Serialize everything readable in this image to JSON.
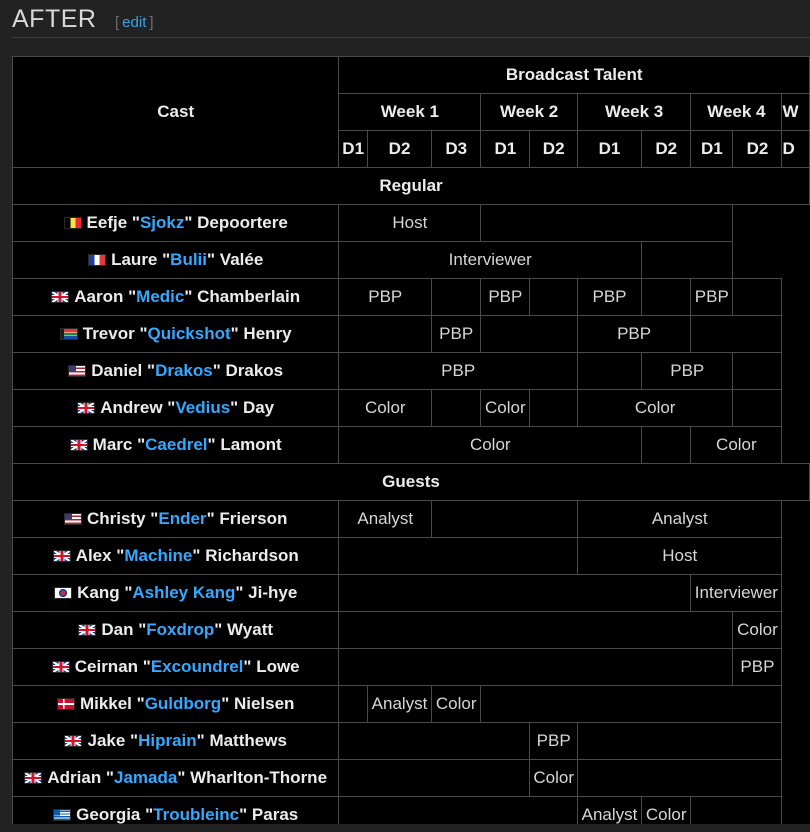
{
  "heading": {
    "title": "AFTER",
    "edit_open": "[",
    "edit_label": "edit",
    "edit_close": "]"
  },
  "table": {
    "header": {
      "cast": "Cast",
      "group": "Broadcast Talent",
      "weeks": [
        "Week 1",
        "Week 2",
        "Week 3",
        "Week 4",
        "W"
      ],
      "days": [
        "D1",
        "D2",
        "D3",
        "D1",
        "D2",
        "D1",
        "D2",
        "D1",
        "D2",
        "D"
      ]
    },
    "sections": [
      {
        "label": "Regular",
        "rows": [
          {
            "first": "Eefje \"",
            "nick": "Sjokz",
            "last": "\" Depoortere",
            "flag": "belgium-flag-icon",
            "cells": [
              {
                "text": "Host",
                "span": 3
              },
              {
                "text": "",
                "span": 5
              }
            ]
          },
          {
            "first": "Laure \"",
            "nick": "Bulii",
            "last": "\" Valée",
            "flag": "france-flag-icon",
            "cells": [
              {
                "text": "Interviewer",
                "span": 6
              },
              {
                "text": "",
                "span": 2
              }
            ]
          },
          {
            "first": "Aaron \"",
            "nick": "Medic",
            "last": "\" Chamberlain",
            "flag": "uk-flag-icon",
            "cells": [
              {
                "text": "PBP",
                "span": 2
              },
              {
                "text": "",
                "span": 1
              },
              {
                "text": "PBP",
                "span": 1
              },
              {
                "text": "",
                "span": 1
              },
              {
                "text": "PBP",
                "span": 1
              },
              {
                "text": "",
                "span": 1
              },
              {
                "text": "PBP",
                "span": 1
              },
              {
                "text": "",
                "span": 1
              }
            ]
          },
          {
            "first": "Trevor \"",
            "nick": "Quickshot",
            "last": "\" Henry",
            "flag": "south-africa-flag-icon",
            "cells": [
              {
                "text": "",
                "span": 2
              },
              {
                "text": "PBP",
                "span": 1
              },
              {
                "text": "",
                "span": 2
              },
              {
                "text": "PBP",
                "span": 2
              },
              {
                "text": "",
                "span": 2
              }
            ]
          },
          {
            "first": "Daniel \"",
            "nick": "Drakos",
            "last": "\" Drakos",
            "flag": "usa-flag-icon",
            "cells": [
              {
                "text": "PBP",
                "span": 5
              },
              {
                "text": "",
                "span": 1
              },
              {
                "text": "PBP",
                "span": 2
              },
              {
                "text": "",
                "span": 1
              }
            ]
          },
          {
            "first": "Andrew \"",
            "nick": "Vedius",
            "last": "\" Day",
            "flag": "uk-flag-icon",
            "cells": [
              {
                "text": "Color",
                "span": 2
              },
              {
                "text": "",
                "span": 1
              },
              {
                "text": "Color",
                "span": 1
              },
              {
                "text": "",
                "span": 1
              },
              {
                "text": "Color",
                "span": 3
              },
              {
                "text": "",
                "span": 1
              }
            ]
          },
          {
            "first": "Marc \"",
            "nick": "Caedrel",
            "last": "\" Lamont",
            "flag": "uk-flag-icon",
            "cells": [
              {
                "text": "Color",
                "span": 6
              },
              {
                "text": "",
                "span": 1
              },
              {
                "text": "Color",
                "span": 2
              }
            ]
          }
        ]
      },
      {
        "label": "Guests",
        "rows": [
          {
            "first": "Christy \"",
            "nick": "Ender",
            "last": "\" Frierson",
            "flag": "usa-flag-icon",
            "cells": [
              {
                "text": "Analyst",
                "span": 2
              },
              {
                "text": "",
                "span": 3
              },
              {
                "text": "Analyst",
                "span": 4
              }
            ]
          },
          {
            "first": "Alex \"",
            "nick": "Machine",
            "last": "\" Richardson",
            "flag": "uk-flag-icon",
            "cells": [
              {
                "text": "",
                "span": 5
              },
              {
                "text": "Host",
                "span": 4
              }
            ]
          },
          {
            "first": "Kang \"",
            "nick": "Ashley Kang",
            "last": "\" Ji-hye",
            "flag": "south-korea-flag-icon",
            "cells": [
              {
                "text": "",
                "span": 7
              },
              {
                "text": "Interviewer",
                "span": 2
              }
            ]
          },
          {
            "first": "Dan \"",
            "nick": "Foxdrop",
            "last": "\" Wyatt",
            "flag": "uk-flag-icon",
            "cells": [
              {
                "text": "",
                "span": 8
              },
              {
                "text": "Color",
                "span": 1
              }
            ]
          },
          {
            "first": "Ceirnan \"",
            "nick": "Excoundrel",
            "last": "\" Lowe",
            "flag": "uk-flag-icon",
            "cells": [
              {
                "text": "",
                "span": 8
              },
              {
                "text": "PBP",
                "span": 1
              }
            ]
          },
          {
            "first": "Mikkel \"",
            "nick": "Guldborg",
            "last": "\" Nielsen",
            "flag": "denmark-flag-icon",
            "cells": [
              {
                "text": "",
                "span": 1
              },
              {
                "text": "Analyst",
                "span": 1
              },
              {
                "text": "Color",
                "span": 1
              },
              {
                "text": "",
                "span": 6
              }
            ]
          },
          {
            "first": "Jake \"",
            "nick": "Hiprain",
            "last": "\" Matthews",
            "flag": "uk-flag-icon",
            "cells": [
              {
                "text": "",
                "span": 4
              },
              {
                "text": "PBP",
                "span": 1
              },
              {
                "text": "",
                "span": 4
              }
            ]
          },
          {
            "first": "Adrian \"",
            "nick": "Jamada",
            "last": "\" Wharlton-Thorne",
            "flag": "uk-flag-icon",
            "cells": [
              {
                "text": "",
                "span": 4
              },
              {
                "text": "Color",
                "span": 1
              },
              {
                "text": "",
                "span": 4
              }
            ]
          },
          {
            "first": "Georgia \"",
            "nick": "Troubleinc",
            "last": "\" Paras",
            "flag": "greece-flag-icon",
            "cells": [
              {
                "text": "",
                "span": 5
              },
              {
                "text": "Analyst",
                "span": 1
              },
              {
                "text": "Color",
                "span": 1
              },
              {
                "text": "",
                "span": 2
              }
            ]
          }
        ]
      }
    ]
  }
}
